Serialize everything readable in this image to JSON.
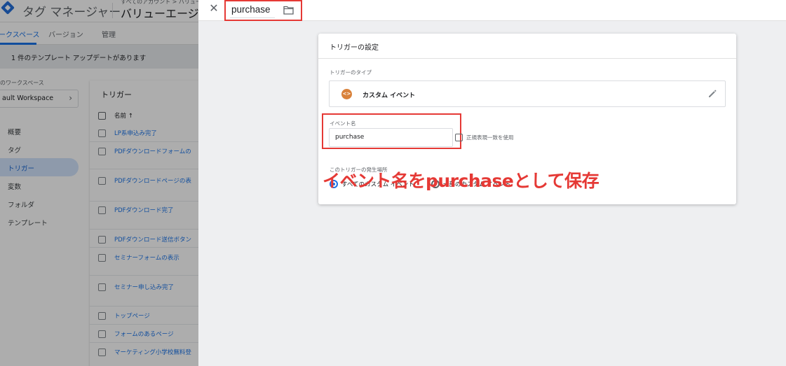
{
  "background_app": {
    "app_title": "タグ マネージャー",
    "breadcrumb": "すべてのアカウント > バリュー",
    "container_name": "バリューエージェ",
    "tabs": [
      {
        "label": "ークスペース",
        "active": true
      },
      {
        "label": "バージョン",
        "active": false
      },
      {
        "label": "管理",
        "active": false
      }
    ],
    "notice": "1 件のテンプレート アップデートがあります",
    "workspace_label": "のワークスペース",
    "workspace_value": "ault Workspace",
    "nav": [
      {
        "label": "概要",
        "active": false
      },
      {
        "label": "タグ",
        "active": false
      },
      {
        "label": "トリガー",
        "active": true
      },
      {
        "label": "変数",
        "active": false
      },
      {
        "label": "フォルダ",
        "active": false
      },
      {
        "label": "テンプレート",
        "active": false
      }
    ],
    "trigger_list": {
      "title": "トリガー",
      "column_header": "名前 ↑",
      "rows": [
        "LP系申込み完了",
        "PDFダウンロードフォームの",
        "PDFダウンロードページの表",
        "PDFダウンロード完了",
        "PDFダウンロード送信ボタン",
        "セミナーフォームの表示",
        "セミナー申し込み完了",
        "トップページ",
        "フォームのあるページ",
        "マーケティング小学校無料登"
      ]
    }
  },
  "panel": {
    "trigger_name": "purchase",
    "card_title": "トリガーの設定",
    "type_label": "トリガーのタイプ",
    "type_icon_glyph": "<>",
    "type_name": "カスタム イベント",
    "event_name_label": "イベント名",
    "event_name_value": "purchase",
    "regex_label": "正規表現一致を使用",
    "fires_on_label": "このトリガーの発生場所",
    "radio_all_label": "すべてのカスタム イベント",
    "radio_some_label": "一部のカスタム イベント"
  },
  "annotation_text": "イベント名をpurchaseとして保存",
  "colors": {
    "highlight_red": "#e53935",
    "accent_blue": "#1a73e8",
    "custom_event_icon": "#d9823b"
  }
}
